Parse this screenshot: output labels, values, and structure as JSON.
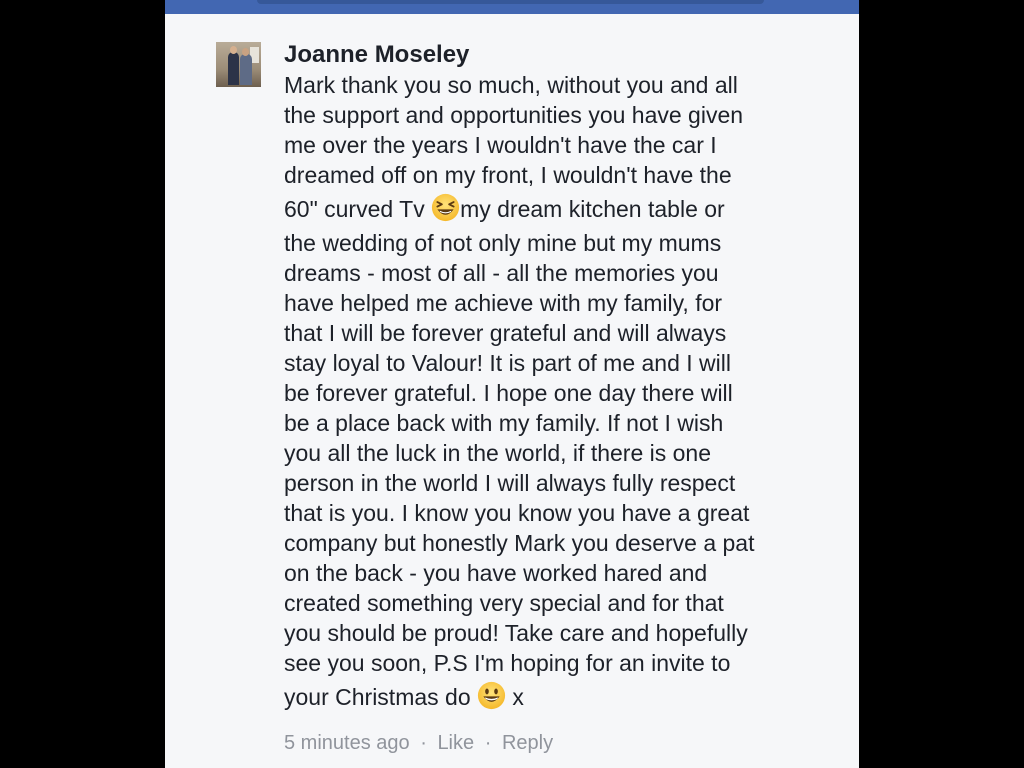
{
  "comment": {
    "author": "Joanne Moseley",
    "lines": [
      "Mark thank you so much, without you and all",
      "the support and opportunities you have given",
      "me over the years I wouldn't have the car I",
      "dreamed off on my front, I wouldn't have the",
      {
        "before": "60\" curved Tv ",
        "emoji": "laughing-emoji",
        "after": "my dream kitchen table or"
      },
      "the wedding of not only mine but my mums",
      "dreams - most of all - all the memories you",
      "have helped me achieve with my family, for",
      "that I will be forever grateful and will always",
      "stay loyal to Valour! It is part of me and I will",
      "be forever grateful. I hope one day there will",
      "be a place back with my family. If not I wish",
      "you all the luck in the world, if there is one",
      "person in the world I will always fully respect",
      "that is you. I know you know you have a great",
      "company but honestly Mark you deserve a pat",
      "on the back - you have worked hared and",
      "created something very special and for that",
      "you should be proud! Take care and hopefully",
      "see you soon, P.S I'm hoping for an invite to",
      {
        "before": "your Christmas do ",
        "emoji": "smiley-emoji",
        "after": " x"
      }
    ],
    "meta": {
      "time": "5 minutes ago",
      "like": "Like",
      "reply": "Reply",
      "separator": "·"
    }
  },
  "colors": {
    "header": "#4267b2",
    "background": "#f6f7f9",
    "text": "#1d2129",
    "meta": "#90949c"
  }
}
